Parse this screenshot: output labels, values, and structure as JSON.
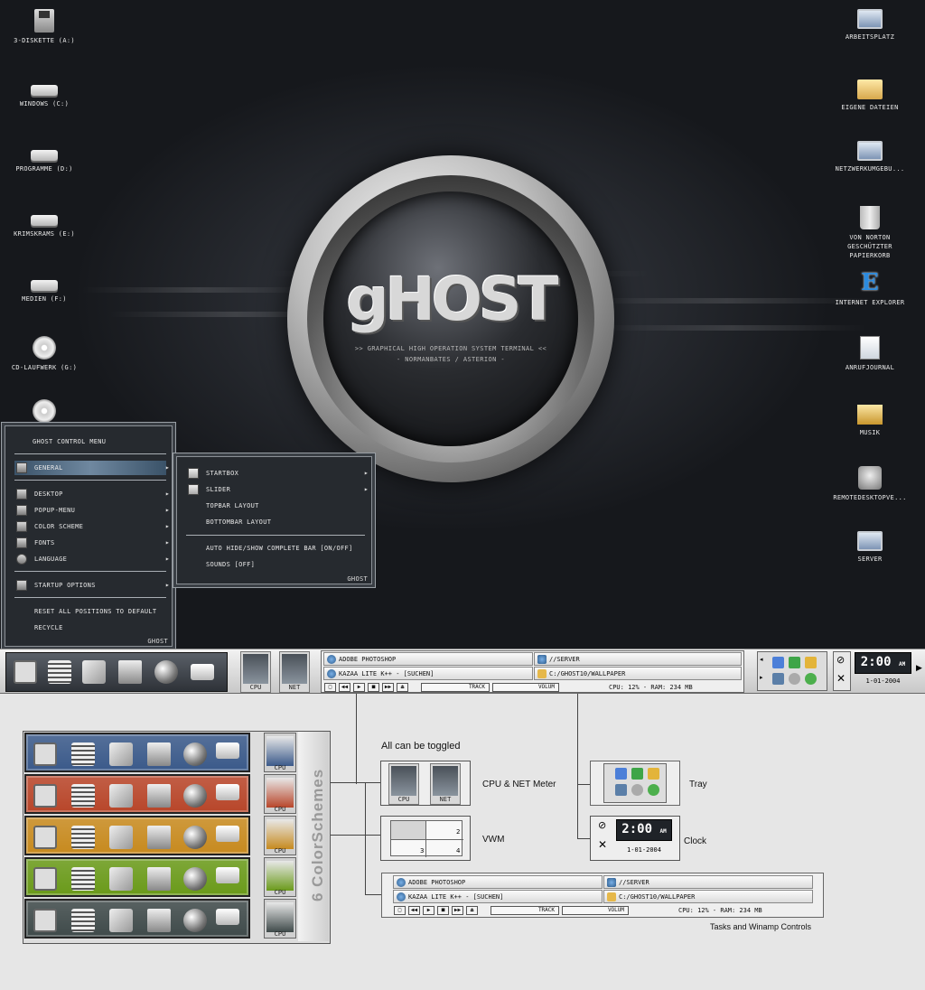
{
  "desktop_icons_left": [
    {
      "label": "3-Diskette (A:)",
      "icon": "floppy-icon"
    },
    {
      "label": "Windows (C:)",
      "icon": "drive-icon"
    },
    {
      "label": "Programme (D:)",
      "icon": "drive-icon"
    },
    {
      "label": "Krimskrams (E:)",
      "icon": "drive-icon"
    },
    {
      "label": "Medien (F:)",
      "icon": "drive-icon"
    },
    {
      "label": "CD-Laufwerk (G:)",
      "icon": "cd-drive-icon"
    },
    {
      "label": "",
      "icon": "cd-drive-icon"
    }
  ],
  "desktop_icons_right": [
    {
      "label": "Arbeitsplatz",
      "icon": "computer-icon"
    },
    {
      "label": "Eigene Dateien",
      "icon": "folder-icon"
    },
    {
      "label": "Netzwerkumgebu...",
      "icon": "network-icon"
    },
    {
      "label": "von Norton geschützter Papierkorb",
      "icon": "recycle-bin-icon"
    },
    {
      "label": "Internet Explorer",
      "icon": "internet-explorer-icon"
    },
    {
      "label": "Anrufjournal",
      "icon": "document-icon"
    },
    {
      "label": "Musik",
      "icon": "music-folder-icon"
    },
    {
      "label": "Remotedesktopve...",
      "icon": "remote-desktop-icon"
    },
    {
      "label": "Server",
      "icon": "server-icon"
    }
  ],
  "logo": {
    "word": "gHOST",
    "tagline": ">> GRAPHICAL HIGH OPERATION SYSTEM TERMINAL <<",
    "credits": "- NORMANBATES / ASTERION -"
  },
  "control_menu": {
    "title": "Ghost Control Menu",
    "items": [
      {
        "label": "General",
        "icon": "folder-icon"
      },
      {
        "label": "Desktop",
        "icon": "desktop-icon"
      },
      {
        "label": "Popup-Menu",
        "icon": "list-icon"
      },
      {
        "label": "Color Scheme",
        "icon": "palette-icon"
      },
      {
        "label": "Fonts",
        "icon": "fonts-icon"
      },
      {
        "label": "Language",
        "icon": "globe-icon"
      },
      {
        "label": "Startup Options",
        "icon": "startup-icon"
      },
      {
        "label": "Reset all positions to default",
        "icon": ""
      },
      {
        "label": "Recycle",
        "icon": ""
      }
    ],
    "brand": "GHOST"
  },
  "sub_menu": {
    "items": [
      {
        "label": "Startbox",
        "icon": "folder-icon"
      },
      {
        "label": "Slider",
        "icon": "folder-icon"
      },
      {
        "label": "Topbar Layout",
        "icon": ""
      },
      {
        "label": "Bottombar Layout",
        "icon": ""
      },
      {
        "label": "Auto hide/show complete bar [on/off]",
        "icon": ""
      },
      {
        "label": "Sounds [off]",
        "icon": ""
      }
    ],
    "brand": "GHOST"
  },
  "taskbar": {
    "meters": {
      "cpu": "CPU",
      "net": "NET"
    },
    "tasks": [
      "ADOBE PHOTOSHOP",
      "KAZAA LITE K++ - [SUCHEN]"
    ],
    "folders": [
      "//SERVER",
      "C:/GHOST10/WALLPAPER"
    ],
    "winamp": {
      "track": "TRACK",
      "volume": "VOLUM"
    },
    "status": "CPU: 12% - RAM: 234 MB",
    "clock_time": "2:00",
    "clock_ampm": "AM",
    "clock_date": "1-01-2004"
  },
  "showcase": {
    "color_schemes_label": "6 ColorSchemes",
    "toggle_label": "All can be toggled",
    "cpu_net_label": "CPU & NET Meter",
    "vwm_label": "VWM",
    "vwm_numbers": [
      "2",
      "3",
      "4"
    ],
    "tray_label": "Tray",
    "clock_label": "Clock",
    "tasks_label": "Tasks and Winamp Controls",
    "schemes": [
      {
        "name": "blue",
        "color": "#3b5a8a"
      },
      {
        "name": "red",
        "color": "#b8462a"
      },
      {
        "name": "orange",
        "color": "#c78a1f"
      },
      {
        "name": "green",
        "color": "#6a9a1a"
      },
      {
        "name": "grey",
        "color": "#3f4a4a"
      }
    ]
  }
}
